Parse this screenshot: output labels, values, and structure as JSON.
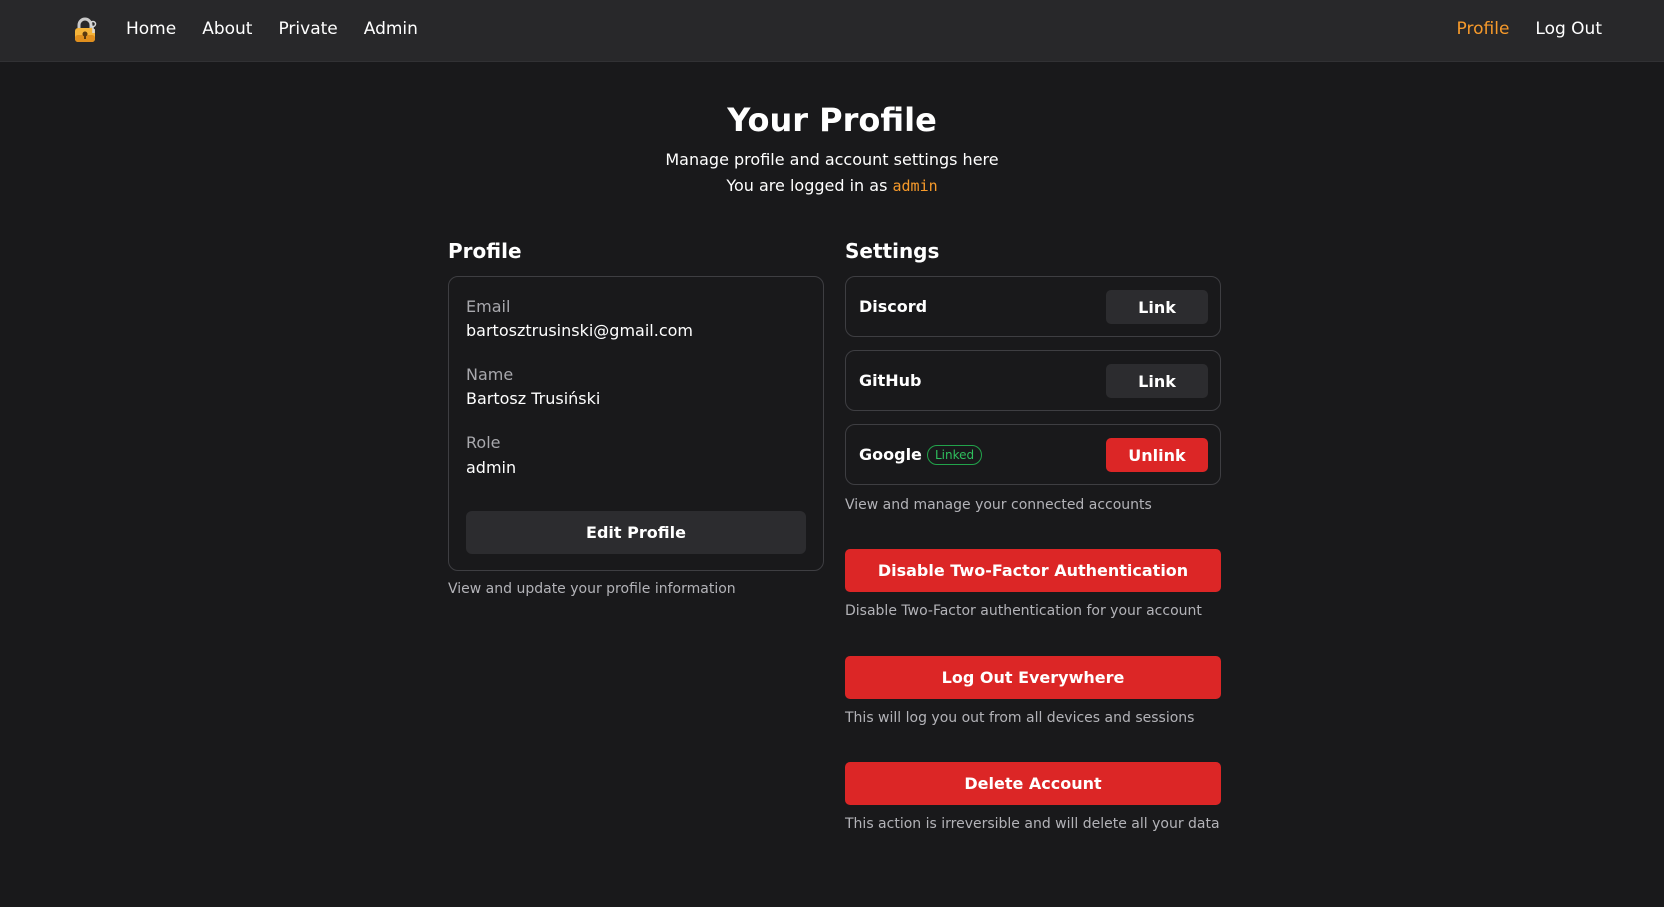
{
  "nav": {
    "logo_icon": "lock-key-icon",
    "links": [
      "Home",
      "About",
      "Private",
      "Admin"
    ],
    "right": {
      "profile": "Profile",
      "logout": "Log Out"
    },
    "accent": "#f79a2a"
  },
  "header": {
    "title": "Your Profile",
    "subtitle": "Manage profile and account settings here",
    "logged_in_prefix": "You are logged in as",
    "username": "admin"
  },
  "profile": {
    "title": "Profile",
    "fields": [
      {
        "label": "Email",
        "value": "bartosztrusinski@gmail.com"
      },
      {
        "label": "Name",
        "value": "Bartosz Trusiński"
      },
      {
        "label": "Role",
        "value": "admin"
      }
    ],
    "edit_button": "Edit Profile",
    "help": "View and update your profile information"
  },
  "settings": {
    "title": "Settings",
    "accounts": [
      {
        "name": "Discord",
        "button": "Link"
      },
      {
        "name": "GitHub",
        "button": "Link"
      },
      {
        "name": "Google",
        "badge": "Linked",
        "button": "Unlink"
      }
    ],
    "accounts_help": "View and manage your connected accounts",
    "two_factor": {
      "button": "Disable Two-Factor Authentication",
      "help": "Disable Two-Factor authentication for your account"
    },
    "logout_all": {
      "button": "Log Out Everywhere",
      "help": "This will log you out from all devices and sessions"
    },
    "delete": {
      "button": "Delete Account",
      "help": "This action is irreversible and will delete all your data"
    },
    "danger_color": "#dc2626",
    "linked_color": "#2fbf5d"
  }
}
